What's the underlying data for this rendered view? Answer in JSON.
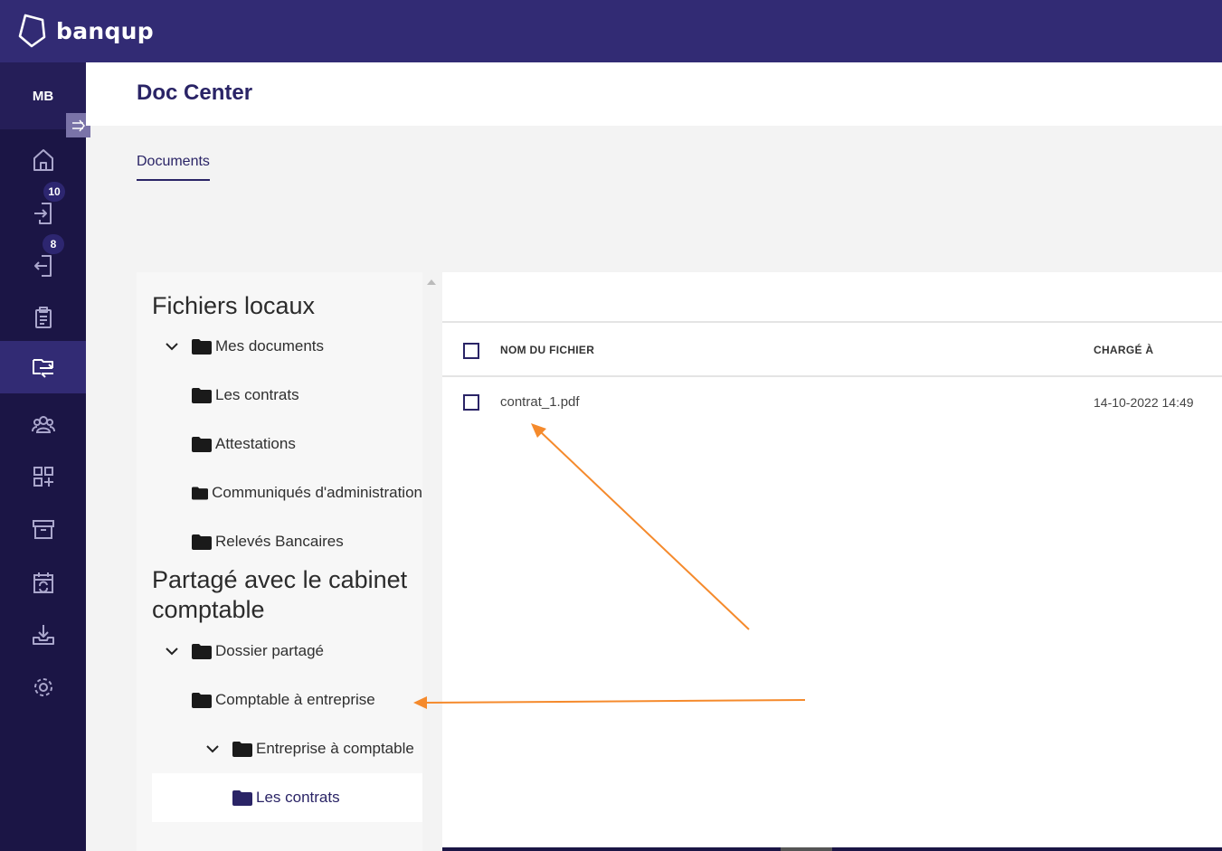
{
  "brand": {
    "name": "banqup"
  },
  "user": {
    "initials": "MB"
  },
  "sidebar": {
    "items": [
      {
        "icon": "home-icon"
      },
      {
        "icon": "inbox-in-icon",
        "badge": "10"
      },
      {
        "icon": "outbox-icon",
        "badge": "8"
      },
      {
        "icon": "clipboard-icon"
      },
      {
        "icon": "doc-transfer-icon",
        "active": true
      },
      {
        "icon": "contacts-icon"
      },
      {
        "icon": "apps-add-icon"
      },
      {
        "icon": "archive-icon"
      },
      {
        "icon": "calendar-sync-icon"
      },
      {
        "icon": "download-tray-icon"
      },
      {
        "icon": "settings-gear-icon"
      }
    ]
  },
  "header": {
    "title": "Doc Center"
  },
  "tabs": {
    "documents": "Documents"
  },
  "tree": {
    "local_title": "Fichiers locaux",
    "local": {
      "root": "Mes documents",
      "children": [
        "Les contrats",
        "Attestations",
        "Communiqués d'administration",
        "Relevés Bancaires"
      ]
    },
    "shared_title": "Partagé avec le cabinet comptable",
    "shared": {
      "root": "Dossier partagé",
      "child1": "Comptable à entreprise",
      "child2": "Entreprise à comptable",
      "grandchild": "Les contrats"
    }
  },
  "table": {
    "col_name": "NOM DU FICHIER",
    "col_date": "CHARGÉ À",
    "rows": [
      {
        "name": "contrat_1.pdf",
        "date": "14-10-2022 14:49"
      }
    ]
  },
  "colors": {
    "brand": "#322b74",
    "sidebar": "#1b1545",
    "annotation": "#f58a2c"
  }
}
